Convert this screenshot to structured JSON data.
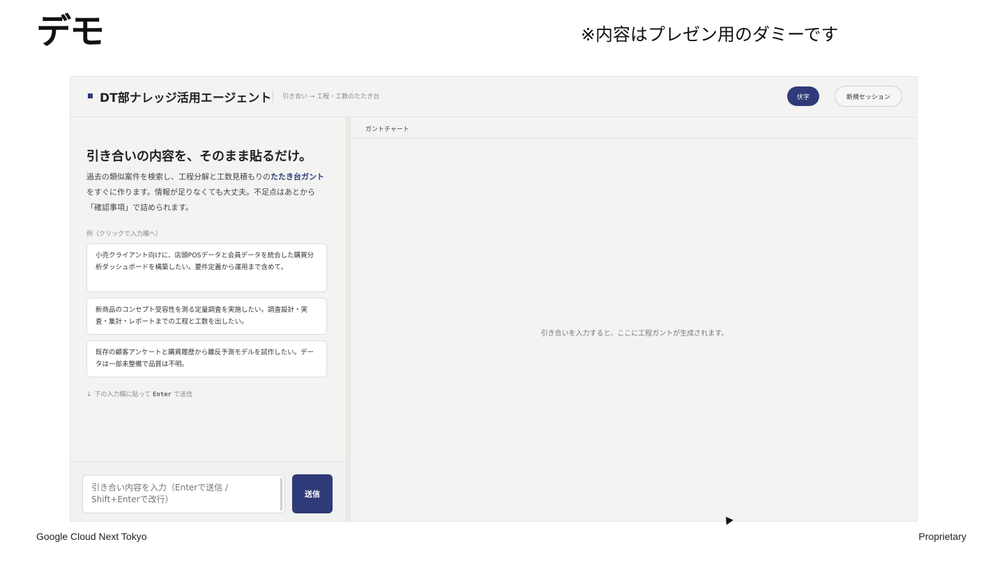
{
  "slide": {
    "title": "デモ",
    "note": "※内容はプレゼン用のダミーです",
    "footer_left": "Google Cloud Next Tokyo",
    "footer_right": "Proprietary"
  },
  "header": {
    "brand": "DT部ナレッジ活用エージェント",
    "breadcrumb": "引き合い → 工程・工数のたたき台",
    "avatar_label": "伏字",
    "new_session_label": "新規セッション"
  },
  "left_pane": {
    "hero_title": "引き合いの内容を、そのまま貼るだけ。",
    "hero_desc_pre": "過去の類似案件を検索し、工程分解と工数見積もりの",
    "hero_desc_bold": "たたき台ガント",
    "hero_desc_post": "をすぐに作ります。情報が足りなくても大丈夫。不足点はあとから「確認事項」で詰められます。",
    "examples_label": "例（クリックで入力欄へ）",
    "examples": [
      "小売クライアント向けに、店頭POSデータと会員データを統合した購買分析ダッシュボードを構築したい。要件定義から運用まで含めて。",
      "新商品のコンセプト受容性を測る定量調査を実施したい。調査設計・実査・集計・レポートまでの工程と工数を出したい。",
      "既存の顧客アンケートと購買履歴から離反予測モデルを試作したい。データは一部未整備で品質は不明。"
    ],
    "hint_arrow": "↓",
    "hint_pre": "下の入力欄に貼って",
    "hint_key": "Enter",
    "hint_post": "で送信"
  },
  "input": {
    "placeholder": "引き合い内容を入力（Enterで送信 / Shift+Enterで改行）",
    "send_label": "送信"
  },
  "right_pane": {
    "title": "ガントチャート",
    "empty_message": "引き合いを入力すると、ここに工程ガントが生成されます。"
  },
  "colors": {
    "accent": "#2f3a78",
    "background": "#f3f3f2"
  }
}
